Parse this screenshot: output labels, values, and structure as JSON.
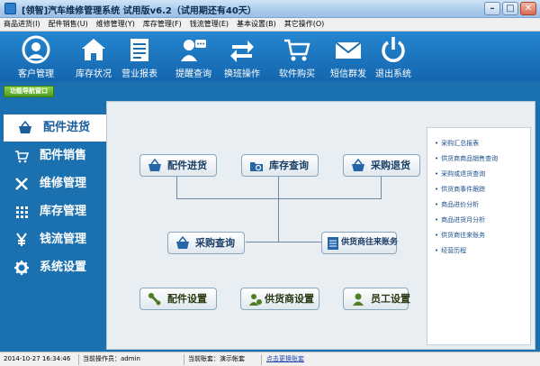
{
  "window": {
    "title": "[领智]汽车维修管理系统 试用版v6.2（试用期还有40天）",
    "minimize": "–",
    "maximize": "□",
    "close": "✕"
  },
  "menu": [
    "商品进货(I)",
    "配件销售(U)",
    "维修管理(Y)",
    "库存管理(F)",
    "钱流管理(E)",
    "基本设置(B)",
    "其它操作(O)"
  ],
  "toolbar": [
    {
      "label": "客户管理",
      "icon": "customer-icon"
    },
    {
      "label": "库存状况",
      "icon": "warehouse-icon"
    },
    {
      "label": "营业报表",
      "icon": "report-icon"
    },
    {
      "label": "提醒查询",
      "icon": "reminder-icon"
    },
    {
      "label": "换班操作",
      "icon": "shift-icon"
    },
    {
      "label": "软件购买",
      "icon": "cart-icon"
    },
    {
      "label": "短信群发",
      "icon": "sms-icon"
    },
    {
      "label": "退出系统",
      "icon": "power-icon"
    }
  ],
  "nav_tag": "功能导航窗口",
  "sidebar": [
    {
      "label": "配件进货",
      "icon": "basket-icon",
      "active": true
    },
    {
      "label": "配件销售",
      "icon": "cart-icon",
      "active": false
    },
    {
      "label": "维修管理",
      "icon": "tools-icon",
      "active": false
    },
    {
      "label": "库存管理",
      "icon": "grid-icon",
      "active": false
    },
    {
      "label": "钱流管理",
      "icon": "yen-icon",
      "active": false
    },
    {
      "label": "系统设置",
      "icon": "gear-icon",
      "active": false
    }
  ],
  "flow": {
    "purchase_in": "配件进货",
    "stock_query": "库存查询",
    "purchase_return": "采购退货",
    "purchase_query": "采购查询",
    "supplier_account": "供货商往来账务",
    "part_settings": "配件设置",
    "supplier_settings": "供货商设置",
    "staff_settings": "员工设置"
  },
  "reports": [
    "采购汇总报表",
    "供货商商品销售查询",
    "采购或退货查询",
    "供货商事件跟踪",
    "商品进价分析",
    "商品进货月分析",
    "供货商往来账务",
    "经营历程"
  ],
  "status": {
    "datetime": "2014-10-27 16:34:46",
    "operator_label": "当前操作员：admin",
    "account_label": "当前账套：演示帐套",
    "switch_link": "点击更换账套"
  },
  "colors": {
    "toolbar": "#1a6fae",
    "panel": "#e9eef2",
    "accent_green": "#5aa82a"
  }
}
